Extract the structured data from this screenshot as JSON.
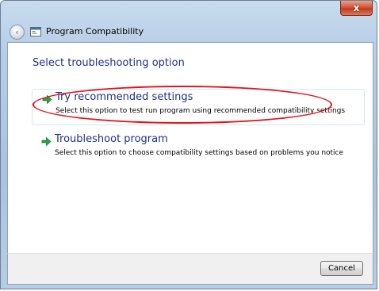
{
  "window": {
    "close_glyph": "x"
  },
  "nav": {
    "back_glyph": "‹",
    "title": "Program Compatibility"
  },
  "main": {
    "heading": "Select troubleshooting option",
    "options": [
      {
        "title": "Try recommended settings",
        "description": "Select this option to test run program using recommended compatibility settings",
        "icon": "green-arrow-icon"
      },
      {
        "title": "Troubleshoot program",
        "description": "Select this option to choose compatibility settings based on problems you notice",
        "icon": "green-arrow-icon"
      }
    ]
  },
  "footer": {
    "cancel_label": "Cancel"
  },
  "colors": {
    "heading": "#1e3287",
    "highlight_ellipse": "#e2141b",
    "arrow_green": "#2fa14a"
  }
}
